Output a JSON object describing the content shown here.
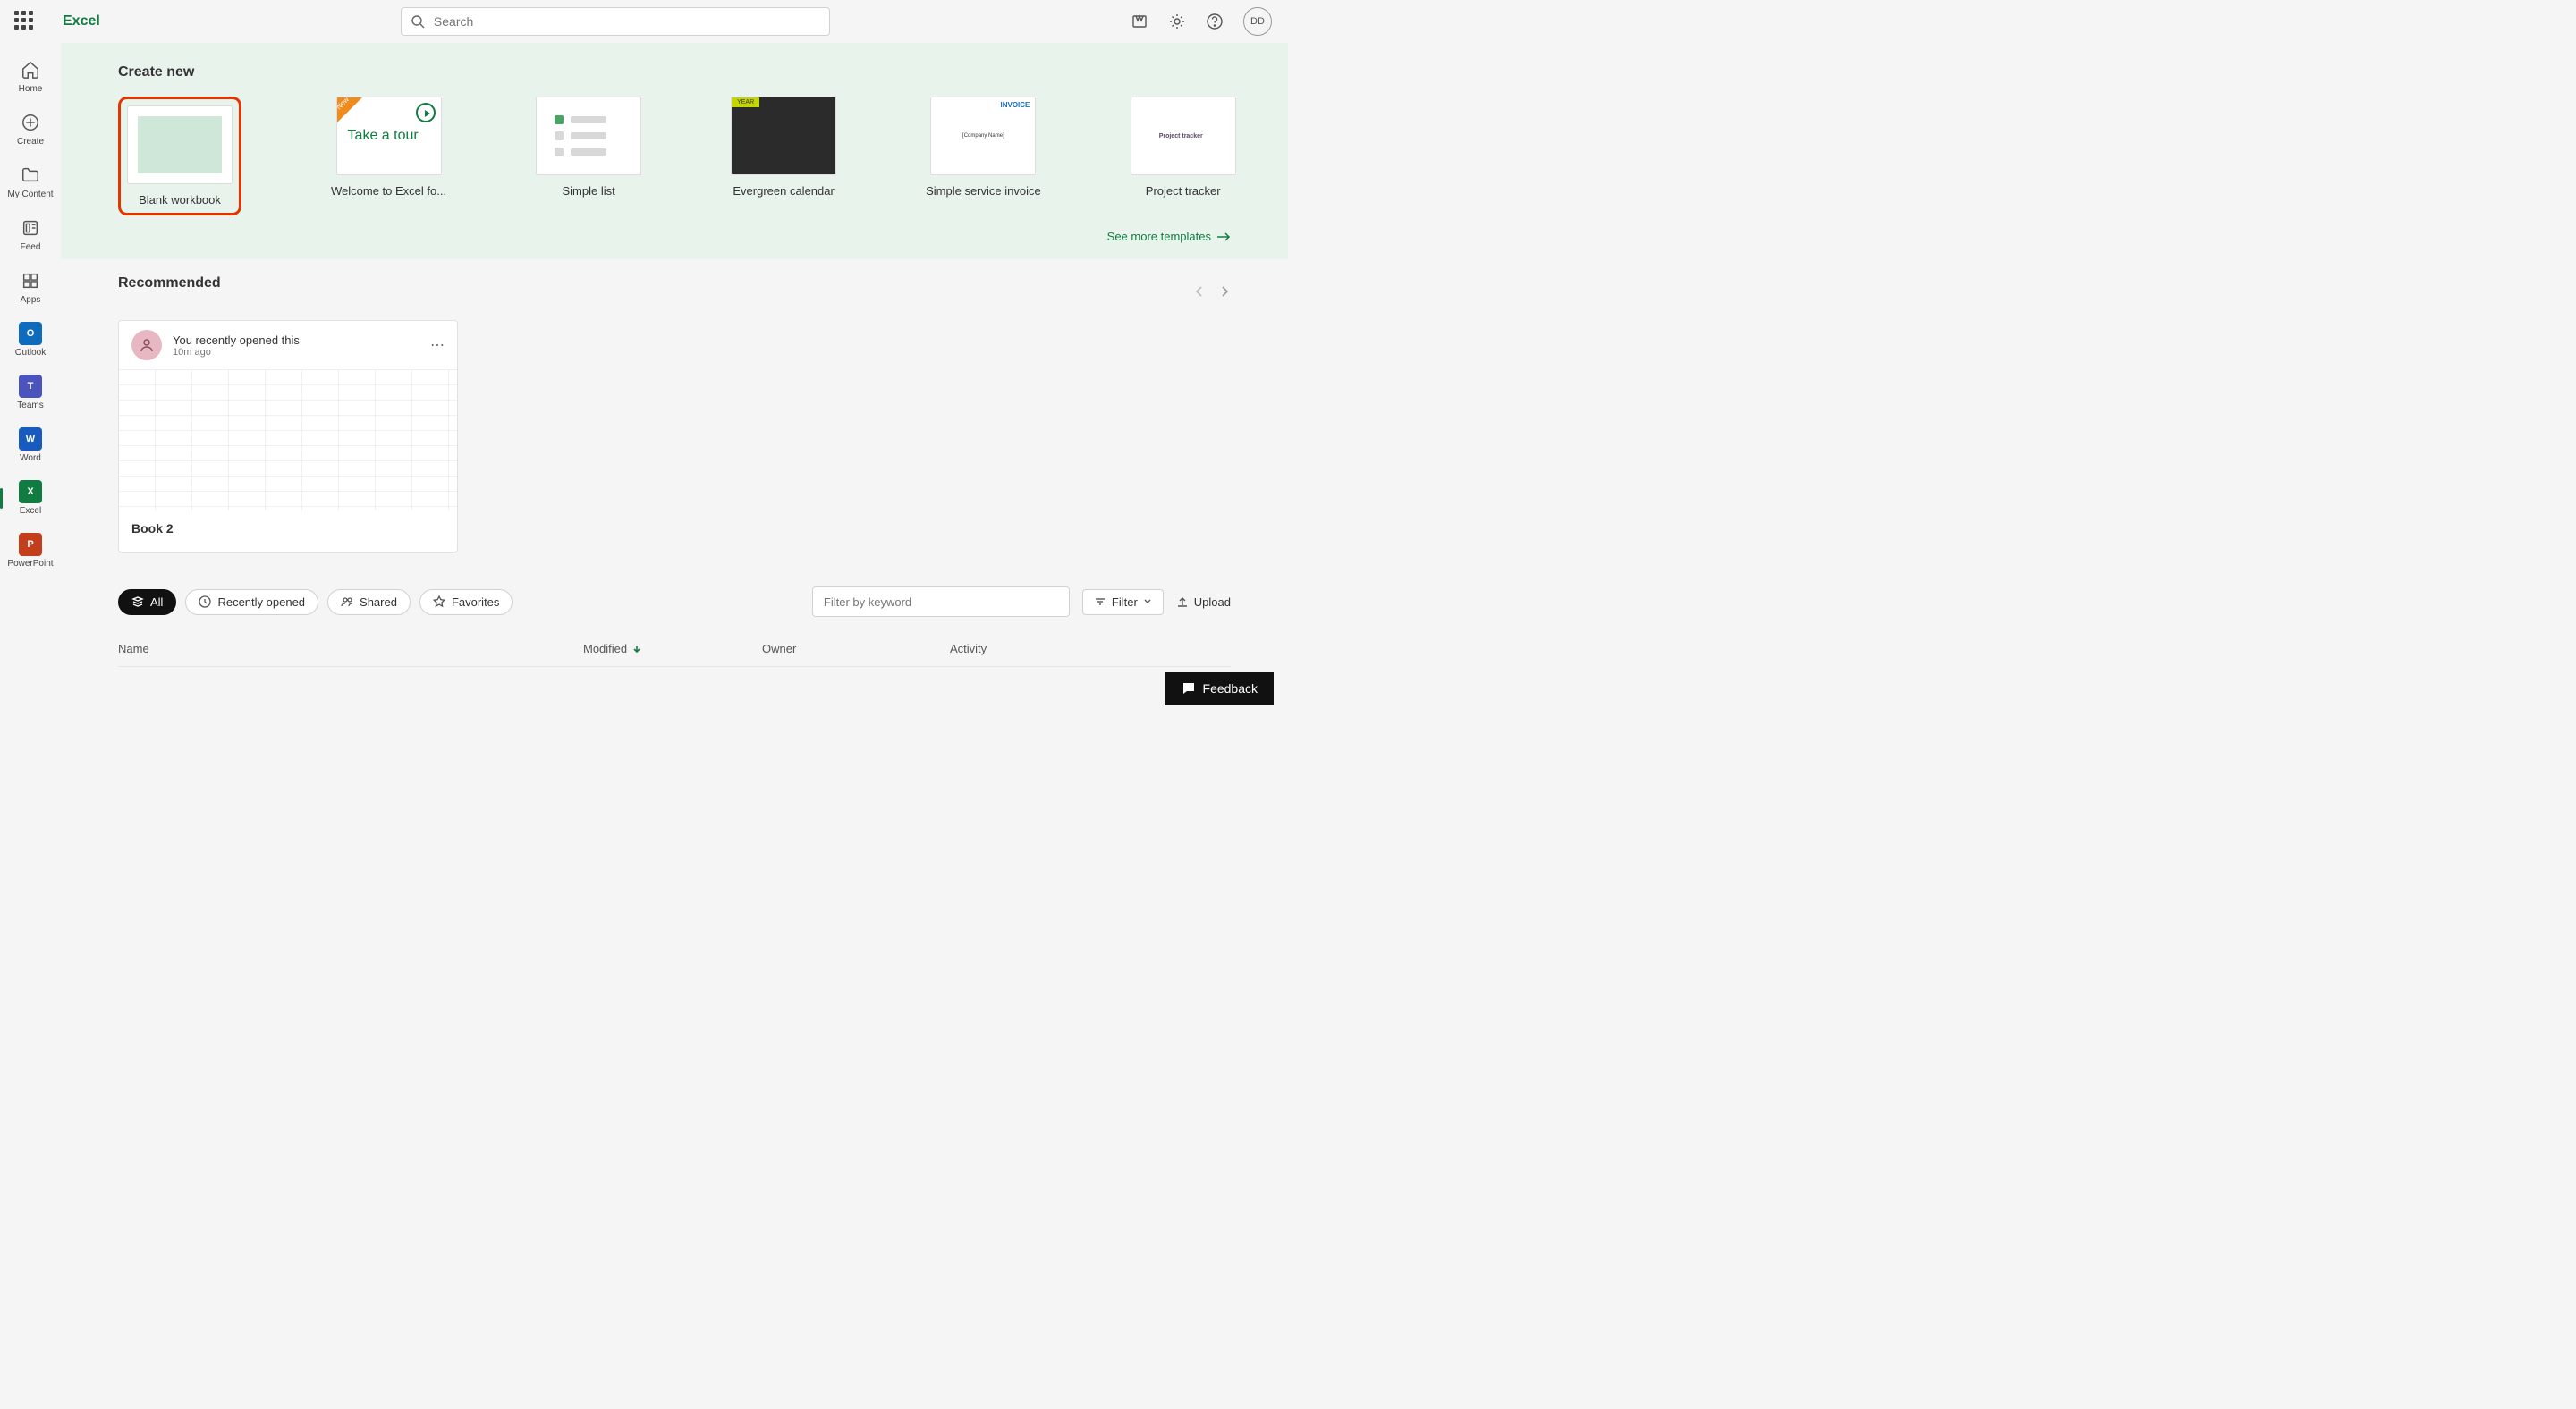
{
  "brand": "Excel",
  "search_placeholder": "Search",
  "avatar_initials": "DD",
  "rail": [
    {
      "label": "Home"
    },
    {
      "label": "Create"
    },
    {
      "label": "My Content"
    },
    {
      "label": "Feed"
    },
    {
      "label": "Apps"
    },
    {
      "label": "Outlook"
    },
    {
      "label": "Teams"
    },
    {
      "label": "Word"
    },
    {
      "label": "Excel"
    },
    {
      "label": "PowerPoint"
    }
  ],
  "create_title": "Create new",
  "templates": [
    {
      "label": "Blank workbook"
    },
    {
      "label": "Welcome to Excel fo..."
    },
    {
      "label": "Simple list"
    },
    {
      "label": "Evergreen calendar"
    },
    {
      "label": "Simple service invoice"
    },
    {
      "label": "Project tracker"
    }
  ],
  "tour_text": "Take a tour",
  "invoice_word": "INVOICE",
  "project_tracker_heading": "Project tracker",
  "calendar_badge": "YEAR",
  "more_templates": "See more templates",
  "recommended_title": "Recommended",
  "rec_card": {
    "line1": "You recently opened this",
    "line2": "10m ago",
    "name": "Book 2"
  },
  "pills": {
    "all": "All",
    "recent": "Recently opened",
    "shared": "Shared",
    "favorites": "Favorites"
  },
  "filter_placeholder": "Filter by keyword",
  "filter_btn": "Filter",
  "upload_btn": "Upload",
  "cols": {
    "name": "Name",
    "modified": "Modified",
    "owner": "Owner",
    "activity": "Activity"
  },
  "feedback": "Feedback",
  "company_name": "[Company Name]"
}
